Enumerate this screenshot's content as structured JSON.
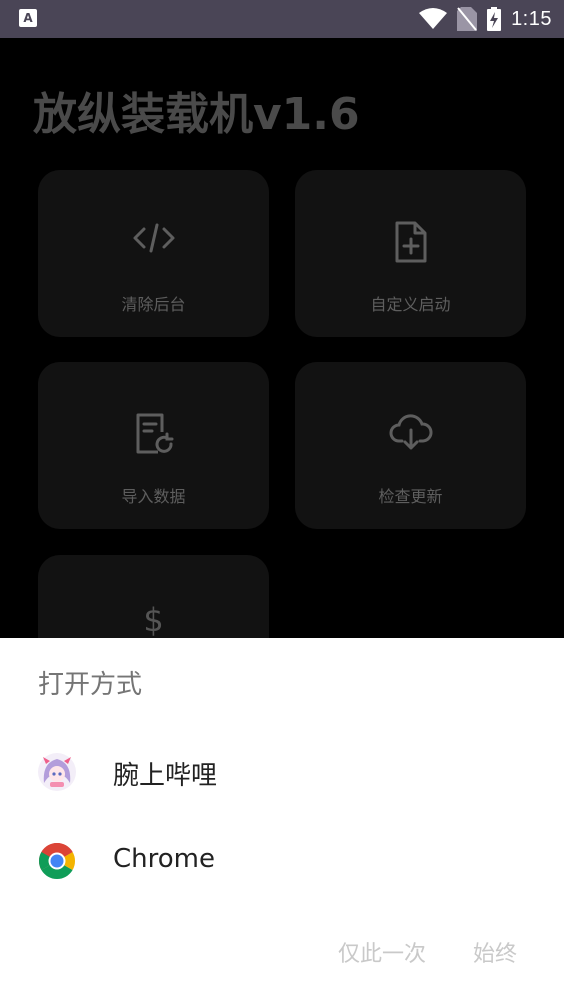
{
  "status_bar": {
    "notification_glyph": "A",
    "time": "1:15",
    "icons": [
      "wifi-icon",
      "no-sim-icon",
      "battery-charging-icon"
    ]
  },
  "app": {
    "title": "放纵装载机v1.6",
    "cards": [
      {
        "label": "清除后台",
        "icon": "code-icon"
      },
      {
        "label": "自定义启动",
        "icon": "file-add-icon"
      },
      {
        "label": "导入数据",
        "icon": "document-refresh-icon"
      },
      {
        "label": "检查更新",
        "icon": "cloud-download-icon"
      },
      {
        "label": "",
        "icon": "dollar-icon",
        "glyph": "$"
      }
    ]
  },
  "chooser": {
    "title": "打开方式",
    "options": [
      {
        "name": "腕上哔哩",
        "icon": "anime-app-icon"
      },
      {
        "name": "Chrome",
        "icon": "chrome-icon"
      }
    ],
    "just_once_label": "仅此一次",
    "always_label": "始终"
  },
  "colors": {
    "status_bar_bg": "#4a4556",
    "app_bg": "#000000",
    "card_bg": "#121212",
    "sheet_bg": "#ffffff"
  }
}
